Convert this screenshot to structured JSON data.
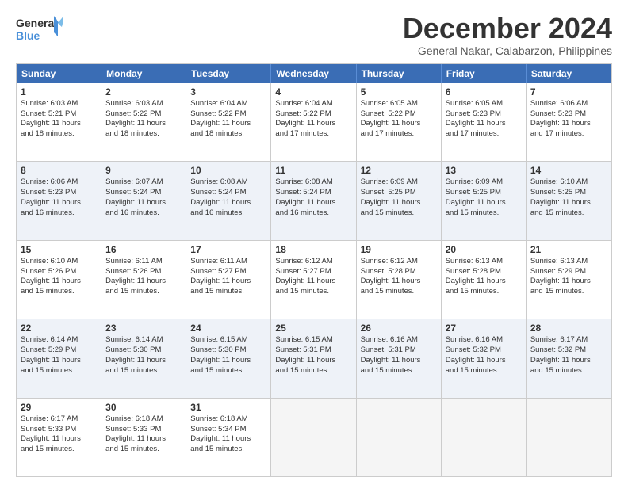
{
  "logo": {
    "line1": "General",
    "line2": "Blue"
  },
  "title": "December 2024",
  "subtitle": "General Nakar, Calabarzon, Philippines",
  "header_days": [
    "Sunday",
    "Monday",
    "Tuesday",
    "Wednesday",
    "Thursday",
    "Friday",
    "Saturday"
  ],
  "rows": [
    {
      "alt": false,
      "cells": [
        {
          "day": "1",
          "info": "Sunrise: 6:03 AM\nSunset: 5:21 PM\nDaylight: 11 hours\nand 18 minutes."
        },
        {
          "day": "2",
          "info": "Sunrise: 6:03 AM\nSunset: 5:22 PM\nDaylight: 11 hours\nand 18 minutes."
        },
        {
          "day": "3",
          "info": "Sunrise: 6:04 AM\nSunset: 5:22 PM\nDaylight: 11 hours\nand 18 minutes."
        },
        {
          "day": "4",
          "info": "Sunrise: 6:04 AM\nSunset: 5:22 PM\nDaylight: 11 hours\nand 17 minutes."
        },
        {
          "day": "5",
          "info": "Sunrise: 6:05 AM\nSunset: 5:22 PM\nDaylight: 11 hours\nand 17 minutes."
        },
        {
          "day": "6",
          "info": "Sunrise: 6:05 AM\nSunset: 5:23 PM\nDaylight: 11 hours\nand 17 minutes."
        },
        {
          "day": "7",
          "info": "Sunrise: 6:06 AM\nSunset: 5:23 PM\nDaylight: 11 hours\nand 17 minutes."
        }
      ]
    },
    {
      "alt": true,
      "cells": [
        {
          "day": "8",
          "info": "Sunrise: 6:06 AM\nSunset: 5:23 PM\nDaylight: 11 hours\nand 16 minutes."
        },
        {
          "day": "9",
          "info": "Sunrise: 6:07 AM\nSunset: 5:24 PM\nDaylight: 11 hours\nand 16 minutes."
        },
        {
          "day": "10",
          "info": "Sunrise: 6:08 AM\nSunset: 5:24 PM\nDaylight: 11 hours\nand 16 minutes."
        },
        {
          "day": "11",
          "info": "Sunrise: 6:08 AM\nSunset: 5:24 PM\nDaylight: 11 hours\nand 16 minutes."
        },
        {
          "day": "12",
          "info": "Sunrise: 6:09 AM\nSunset: 5:25 PM\nDaylight: 11 hours\nand 15 minutes."
        },
        {
          "day": "13",
          "info": "Sunrise: 6:09 AM\nSunset: 5:25 PM\nDaylight: 11 hours\nand 15 minutes."
        },
        {
          "day": "14",
          "info": "Sunrise: 6:10 AM\nSunset: 5:25 PM\nDaylight: 11 hours\nand 15 minutes."
        }
      ]
    },
    {
      "alt": false,
      "cells": [
        {
          "day": "15",
          "info": "Sunrise: 6:10 AM\nSunset: 5:26 PM\nDaylight: 11 hours\nand 15 minutes."
        },
        {
          "day": "16",
          "info": "Sunrise: 6:11 AM\nSunset: 5:26 PM\nDaylight: 11 hours\nand 15 minutes."
        },
        {
          "day": "17",
          "info": "Sunrise: 6:11 AM\nSunset: 5:27 PM\nDaylight: 11 hours\nand 15 minutes."
        },
        {
          "day": "18",
          "info": "Sunrise: 6:12 AM\nSunset: 5:27 PM\nDaylight: 11 hours\nand 15 minutes."
        },
        {
          "day": "19",
          "info": "Sunrise: 6:12 AM\nSunset: 5:28 PM\nDaylight: 11 hours\nand 15 minutes."
        },
        {
          "day": "20",
          "info": "Sunrise: 6:13 AM\nSunset: 5:28 PM\nDaylight: 11 hours\nand 15 minutes."
        },
        {
          "day": "21",
          "info": "Sunrise: 6:13 AM\nSunset: 5:29 PM\nDaylight: 11 hours\nand 15 minutes."
        }
      ]
    },
    {
      "alt": true,
      "cells": [
        {
          "day": "22",
          "info": "Sunrise: 6:14 AM\nSunset: 5:29 PM\nDaylight: 11 hours\nand 15 minutes."
        },
        {
          "day": "23",
          "info": "Sunrise: 6:14 AM\nSunset: 5:30 PM\nDaylight: 11 hours\nand 15 minutes."
        },
        {
          "day": "24",
          "info": "Sunrise: 6:15 AM\nSunset: 5:30 PM\nDaylight: 11 hours\nand 15 minutes."
        },
        {
          "day": "25",
          "info": "Sunrise: 6:15 AM\nSunset: 5:31 PM\nDaylight: 11 hours\nand 15 minutes."
        },
        {
          "day": "26",
          "info": "Sunrise: 6:16 AM\nSunset: 5:31 PM\nDaylight: 11 hours\nand 15 minutes."
        },
        {
          "day": "27",
          "info": "Sunrise: 6:16 AM\nSunset: 5:32 PM\nDaylight: 11 hours\nand 15 minutes."
        },
        {
          "day": "28",
          "info": "Sunrise: 6:17 AM\nSunset: 5:32 PM\nDaylight: 11 hours\nand 15 minutes."
        }
      ]
    },
    {
      "alt": false,
      "cells": [
        {
          "day": "29",
          "info": "Sunrise: 6:17 AM\nSunset: 5:33 PM\nDaylight: 11 hours\nand 15 minutes."
        },
        {
          "day": "30",
          "info": "Sunrise: 6:18 AM\nSunset: 5:33 PM\nDaylight: 11 hours\nand 15 minutes."
        },
        {
          "day": "31",
          "info": "Sunrise: 6:18 AM\nSunset: 5:34 PM\nDaylight: 11 hours\nand 15 minutes."
        },
        {
          "day": "",
          "info": ""
        },
        {
          "day": "",
          "info": ""
        },
        {
          "day": "",
          "info": ""
        },
        {
          "day": "",
          "info": ""
        }
      ]
    }
  ]
}
